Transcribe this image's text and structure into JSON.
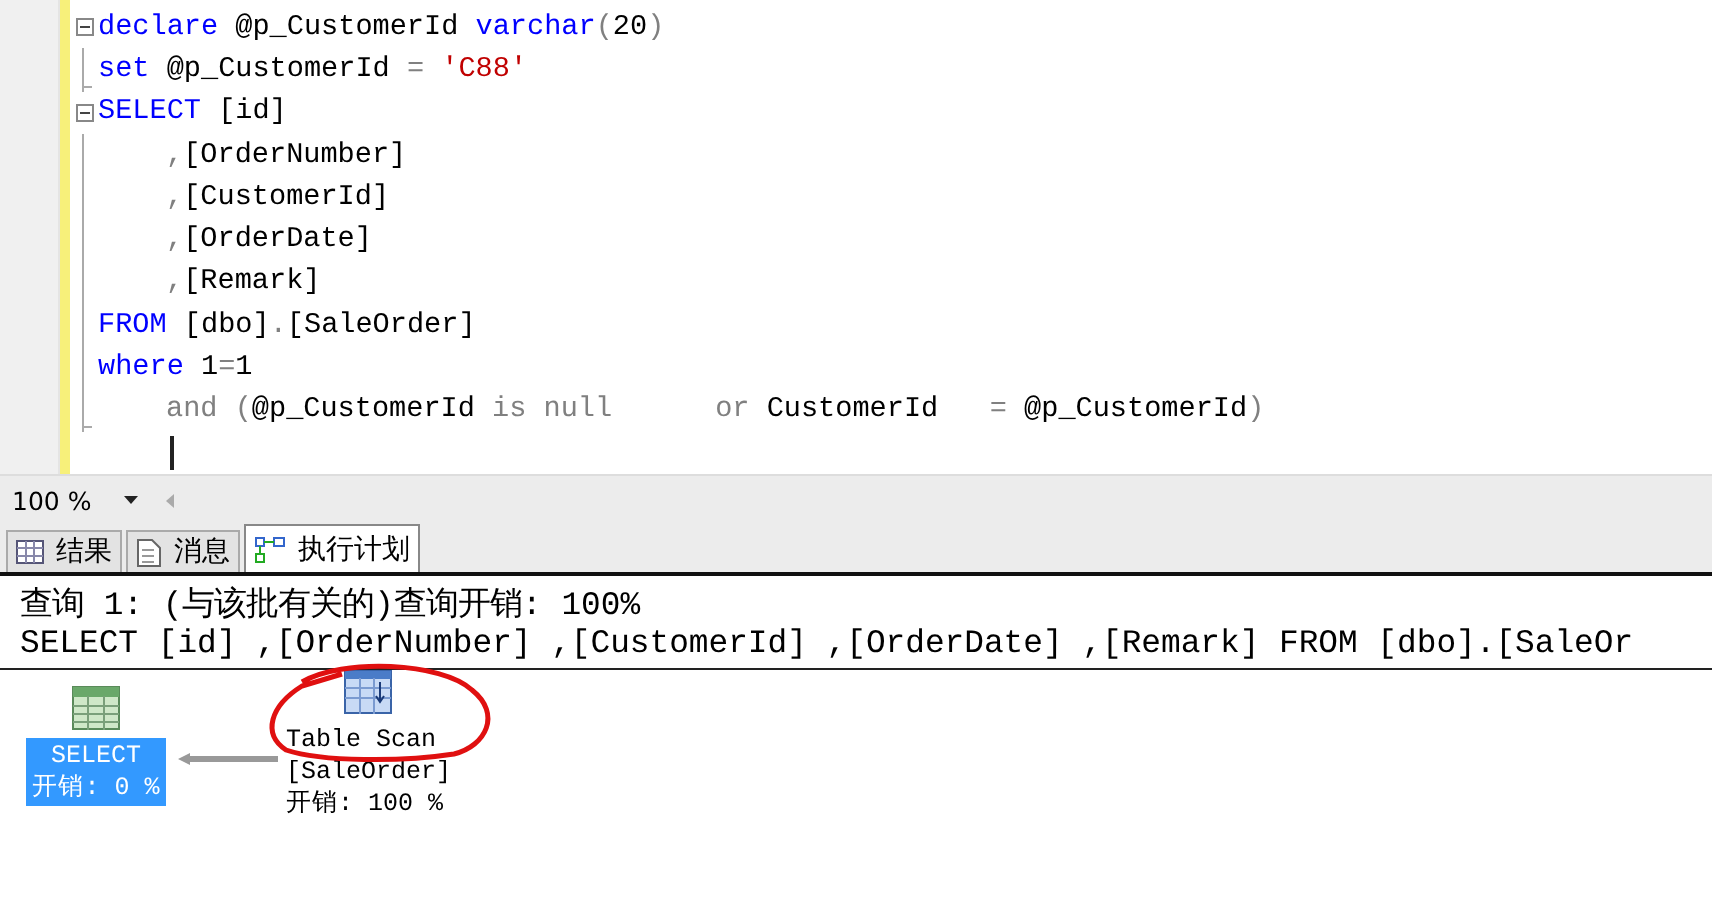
{
  "editor": {
    "lines": [
      {
        "kind": "fold-start",
        "indented": false,
        "tokens": [
          {
            "kind": "keyword",
            "text": "declare"
          },
          {
            "kind": "plain",
            "text": " @p_CustomerId "
          },
          {
            "kind": "keyword",
            "text": "varchar"
          },
          {
            "kind": "op",
            "text": "("
          },
          {
            "kind": "plain",
            "text": "20"
          },
          {
            "kind": "op",
            "text": ")"
          }
        ]
      },
      {
        "kind": "fold-end",
        "indented": false,
        "tokens": [
          {
            "kind": "keyword",
            "text": "set"
          },
          {
            "kind": "plain",
            "text": " @p_CustomerId "
          },
          {
            "kind": "op",
            "text": "= "
          },
          {
            "kind": "string",
            "text": "'C88'"
          }
        ]
      },
      {
        "kind": "fold-start",
        "indented": false,
        "tokens": [
          {
            "kind": "keyword",
            "text": "SELECT"
          },
          {
            "kind": "plain",
            "text": " [id]"
          }
        ]
      },
      {
        "kind": "body",
        "indented": true,
        "tokens": [
          {
            "kind": "op",
            "text": ","
          },
          {
            "kind": "plain",
            "text": "[OrderNumber]"
          }
        ]
      },
      {
        "kind": "body",
        "indented": true,
        "tokens": [
          {
            "kind": "op",
            "text": ","
          },
          {
            "kind": "plain",
            "text": "[CustomerId]"
          }
        ]
      },
      {
        "kind": "body",
        "indented": true,
        "tokens": [
          {
            "kind": "op",
            "text": ","
          },
          {
            "kind": "plain",
            "text": "[OrderDate]"
          }
        ]
      },
      {
        "kind": "body",
        "indented": true,
        "tokens": [
          {
            "kind": "op",
            "text": ","
          },
          {
            "kind": "plain",
            "text": "[Remark]"
          }
        ]
      },
      {
        "kind": "body",
        "indented": false,
        "tokens": [
          {
            "kind": "keyword",
            "text": "FROM"
          },
          {
            "kind": "plain",
            "text": " [dbo]"
          },
          {
            "kind": "op",
            "text": "."
          },
          {
            "kind": "plain",
            "text": "[SaleOrder]"
          }
        ]
      },
      {
        "kind": "body",
        "indented": false,
        "tokens": [
          {
            "kind": "keyword",
            "text": "where"
          },
          {
            "kind": "plain",
            "text": " 1"
          },
          {
            "kind": "op",
            "text": "="
          },
          {
            "kind": "plain",
            "text": "1"
          }
        ]
      },
      {
        "kind": "fold-end",
        "indented": true,
        "tokens": [
          {
            "kind": "op",
            "text": "and ("
          },
          {
            "kind": "plain",
            "text": "@p_CustomerId "
          },
          {
            "kind": "op",
            "text": "is null      or"
          },
          {
            "kind": "plain",
            "text": " CustomerId   "
          },
          {
            "kind": "op",
            "text": "="
          },
          {
            "kind": "plain",
            "text": " @p_CustomerId"
          },
          {
            "kind": "op",
            "text": ")"
          }
        ]
      }
    ]
  },
  "zoom": {
    "value": "100 %"
  },
  "tabs": [
    {
      "kind": "grid",
      "label": "结果",
      "selected": false
    },
    {
      "kind": "messages",
      "label": "消息",
      "selected": false
    },
    {
      "kind": "plan",
      "label": "执行计划",
      "selected": true
    }
  ],
  "plan": {
    "query_header": "查询 1: (与该批有关的)查询开销: 100%",
    "query_text": "SELECT [id] ,[OrderNumber] ,[CustomerId] ,[OrderDate] ,[Remark] FROM [dbo].[SaleOr",
    "nodes": [
      {
        "kind": "select",
        "name": "SELECT",
        "cost": "开销: 0 %",
        "selected": true
      },
      {
        "kind": "scan",
        "name": "Table Scan",
        "object": "[SaleOrder]",
        "cost": "开销: 100 %",
        "selected": false
      }
    ]
  }
}
